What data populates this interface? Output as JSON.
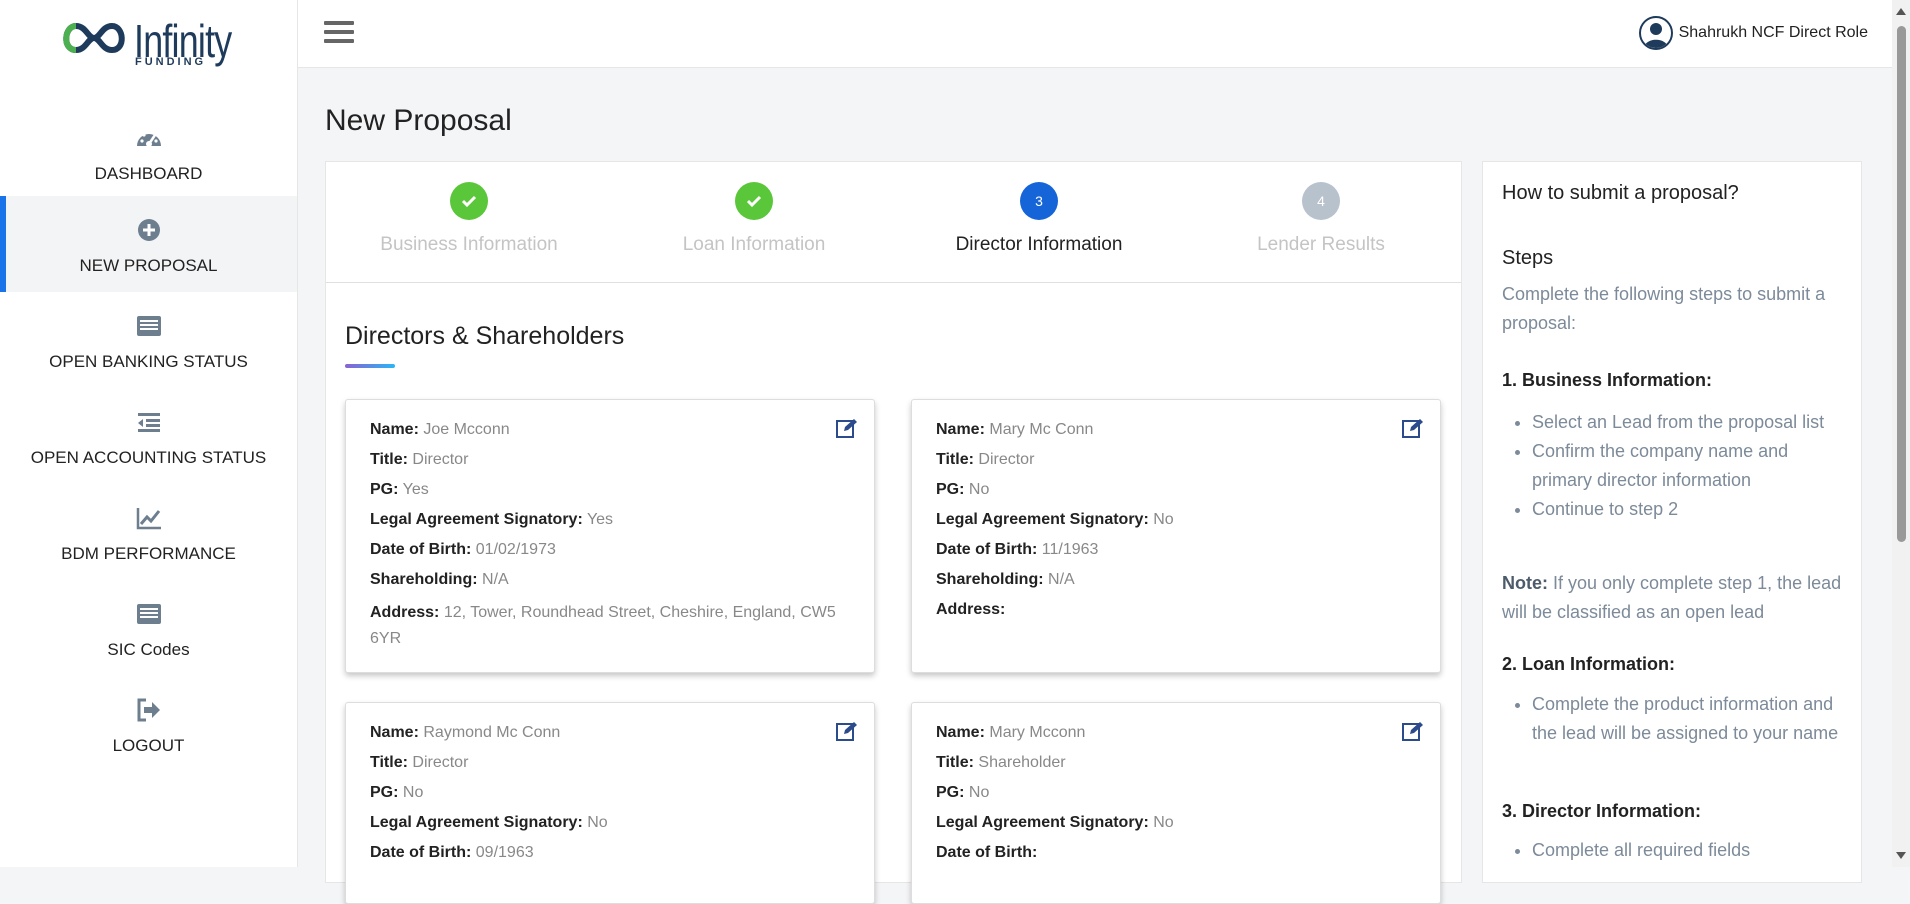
{
  "logo": {
    "word": "Infinity",
    "sub": "FUNDING"
  },
  "sidebar": {
    "items": [
      {
        "label": "DASHBOARD",
        "icon": "dashboard-gauge-icon"
      },
      {
        "label": "NEW PROPOSAL",
        "icon": "plus-circle-icon",
        "active": true
      },
      {
        "label": "OPEN BANKING STATUS",
        "icon": "list-card-icon"
      },
      {
        "label": "OPEN ACCOUNTING STATUS",
        "icon": "indent-list-icon"
      },
      {
        "label": "BDM PERFORMANCE",
        "icon": "line-chart-icon"
      },
      {
        "label": "SIC Codes",
        "icon": "list-card-icon"
      },
      {
        "label": "LOGOUT",
        "icon": "sign-out-icon"
      }
    ]
  },
  "header": {
    "user_name": "Shahrukh NCF Direct Role"
  },
  "page": {
    "title": "New Proposal"
  },
  "stepper": {
    "steps": [
      {
        "number": "",
        "label": "Business Information",
        "state": "done"
      },
      {
        "number": "",
        "label": "Loan Information",
        "state": "done"
      },
      {
        "number": "3",
        "label": "Director Information",
        "state": "current"
      },
      {
        "number": "4",
        "label": "Lender Results",
        "state": "todo"
      }
    ]
  },
  "section": {
    "title": "Directors & Shareholders"
  },
  "field_labels": {
    "name": "Name:",
    "title": "Title:",
    "pg": "PG:",
    "signatory": "Legal Agreement Signatory:",
    "dob": "Date of Birth:",
    "shareholding": "Shareholding:",
    "address": "Address:"
  },
  "directors": [
    {
      "name": "Joe Mcconn",
      "title": "Director",
      "pg": "Yes",
      "signatory": "Yes",
      "dob": "01/02/1973",
      "shareholding": "N/A",
      "address": "12, Tower, Roundhead Street, Cheshire, England, CW5 6YR"
    },
    {
      "name": "Mary Mc Conn",
      "title": "Director",
      "pg": "No",
      "signatory": "No",
      "dob": "11/1963",
      "shareholding": "N/A",
      "address": ""
    },
    {
      "name": "Raymond Mc Conn",
      "title": "Director",
      "pg": "No",
      "signatory": "No",
      "dob": "09/1963"
    },
    {
      "name": "Mary Mcconn",
      "title": "Shareholder",
      "pg": "No",
      "signatory": "No",
      "dob": ""
    }
  ],
  "help": {
    "title": "How to submit a proposal?",
    "steps_heading": "Steps",
    "intro": "Complete the following steps to submit a proposal:",
    "sections": [
      {
        "heading": "1. Business Information:",
        "bullets": [
          "Select an Lead from the proposal list",
          "Confirm the company name and primary director information",
          "Continue to step 2"
        ]
      },
      {
        "heading": "2. Loan Information:",
        "bullets": [
          "Complete the product information and the lead will be assigned to your name"
        ]
      },
      {
        "heading": "3. Director Information:",
        "bullets": [
          "Complete all required fields"
        ]
      }
    ],
    "note_label": "Note:",
    "note_text": " If you only complete step 1, the lead will be classified as an open lead"
  },
  "colors": {
    "accent": "#1a73e8",
    "done": "#5ac73a",
    "current": "#1565d8",
    "todo": "#b8c2cc",
    "brand": "#1f3b5c"
  }
}
